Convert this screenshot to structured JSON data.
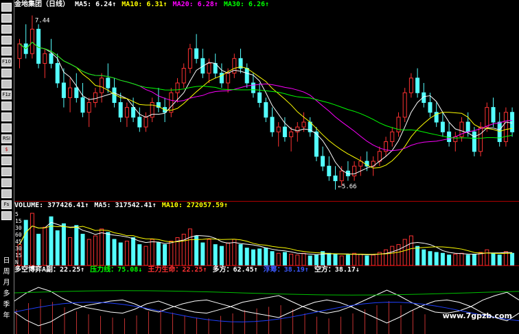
{
  "toolbar": {
    "items": [
      "",
      "",
      "",
      "",
      "",
      "F10",
      "",
      "",
      "F1z",
      "",
      "",
      "",
      "RSI",
      "$",
      "",
      "",
      "",
      "",
      "Fs",
      "",
      "日",
      "周",
      "月",
      "多",
      "季",
      "年"
    ]
  },
  "price_legend": {
    "name": "金地集团（日线）",
    "ma5": "MA5: 6.24↑",
    "ma10": "MA10: 6.31↑",
    "ma20": "MA20: 6.28↑",
    "ma30": "MA30: 6.26↑"
  },
  "high_label": "7.44",
  "low_label": "←5.66",
  "volume_legend": {
    "vol": "VOLUME: 377426.41↑",
    "ma5": "MA5: 317542.41↑",
    "ma10": "MA10: 272057.59↑"
  },
  "volume_axis": [
    "5",
    "15",
    "30",
    "60",
    "45",
    "30",
    "15",
    "N"
  ],
  "indicator_legend": {
    "name": "多空博弈A副：22.25↑",
    "pressure": "压力线：75.08↓",
    "main": "王力生命：22.25↑",
    "bull": "多方：62.45↑",
    "float": "浮筹：38.19↑",
    "bear": "空方：38.17↓"
  },
  "watermark": "www.7gpzb.com",
  "colors": {
    "up": "#ff3232",
    "down": "#54ffff",
    "ma5": "#ffffff",
    "ma10": "#ffff00",
    "ma20": "#ff00ff",
    "ma30": "#00ff00",
    "grid": "#b00000"
  },
  "chart_data": {
    "type": "candlestick",
    "title": "金地集团（日线）",
    "price_ylim": [
      5.6,
      7.5
    ],
    "candles": [
      [
        7.0,
        7.2,
        6.9,
        7.15
      ],
      [
        7.15,
        7.35,
        7.0,
        7.05
      ],
      [
        7.05,
        7.44,
        7.0,
        7.3
      ],
      [
        7.3,
        7.35,
        6.9,
        6.95
      ],
      [
        6.95,
        7.1,
        6.8,
        7.05
      ],
      [
        7.05,
        7.2,
        6.9,
        6.95
      ],
      [
        6.95,
        7.05,
        6.7,
        6.75
      ],
      [
        6.75,
        6.9,
        6.5,
        6.6
      ],
      [
        6.6,
        6.8,
        6.45,
        6.7
      ],
      [
        6.7,
        6.85,
        6.55,
        6.6
      ],
      [
        6.6,
        6.75,
        6.4,
        6.45
      ],
      [
        6.45,
        6.6,
        6.3,
        6.55
      ],
      [
        6.55,
        6.7,
        6.5,
        6.65
      ],
      [
        6.65,
        6.85,
        6.55,
        6.8
      ],
      [
        6.8,
        6.95,
        6.65,
        6.7
      ],
      [
        6.7,
        6.8,
        6.5,
        6.55
      ],
      [
        6.55,
        6.65,
        6.35,
        6.4
      ],
      [
        6.4,
        6.55,
        6.3,
        6.5
      ],
      [
        6.5,
        6.6,
        6.35,
        6.4
      ],
      [
        6.4,
        6.5,
        6.25,
        6.3
      ],
      [
        6.3,
        6.45,
        6.25,
        6.4
      ],
      [
        6.4,
        6.6,
        6.35,
        6.55
      ],
      [
        6.55,
        6.7,
        6.45,
        6.5
      ],
      [
        6.5,
        6.6,
        6.35,
        6.45
      ],
      [
        6.45,
        6.7,
        6.4,
        6.65
      ],
      [
        6.65,
        6.8,
        6.55,
        6.75
      ],
      [
        6.75,
        6.95,
        6.7,
        6.9
      ],
      [
        6.9,
        7.15,
        6.85,
        7.1
      ],
      [
        7.1,
        7.25,
        6.95,
        7.0
      ],
      [
        7.0,
        7.1,
        6.8,
        6.85
      ],
      [
        6.85,
        7.0,
        6.75,
        6.95
      ],
      [
        6.95,
        7.05,
        6.8,
        6.85
      ],
      [
        6.85,
        6.95,
        6.7,
        6.75
      ],
      [
        6.75,
        6.9,
        6.65,
        6.85
      ],
      [
        6.85,
        7.05,
        6.8,
        7.0
      ],
      [
        7.0,
        7.1,
        6.85,
        6.9
      ],
      [
        6.9,
        6.95,
        6.7,
        6.75
      ],
      [
        6.75,
        6.85,
        6.6,
        6.65
      ],
      [
        6.65,
        6.75,
        6.5,
        6.55
      ],
      [
        6.55,
        6.6,
        6.35,
        6.4
      ],
      [
        6.4,
        6.5,
        6.2,
        6.25
      ],
      [
        6.25,
        6.35,
        6.1,
        6.3
      ],
      [
        6.3,
        6.4,
        6.15,
        6.2
      ],
      [
        6.2,
        6.3,
        6.05,
        6.25
      ],
      [
        6.25,
        6.35,
        6.15,
        6.3
      ],
      [
        6.3,
        6.45,
        6.25,
        6.35
      ],
      [
        6.35,
        6.4,
        6.2,
        6.25
      ],
      [
        6.25,
        6.3,
        5.95,
        6.0
      ],
      [
        6.0,
        6.1,
        5.85,
        5.9
      ],
      [
        5.9,
        6.0,
        5.75,
        5.8
      ],
      [
        5.8,
        5.9,
        5.66,
        5.75
      ],
      [
        5.75,
        5.9,
        5.7,
        5.85
      ],
      [
        5.85,
        5.95,
        5.75,
        5.8
      ],
      [
        5.8,
        5.95,
        5.75,
        5.9
      ],
      [
        5.9,
        6.0,
        5.8,
        5.95
      ],
      [
        5.95,
        6.05,
        5.85,
        5.9
      ],
      [
        5.9,
        6.0,
        5.8,
        5.95
      ],
      [
        5.95,
        6.1,
        5.9,
        6.05
      ],
      [
        6.05,
        6.2,
        6.0,
        6.15
      ],
      [
        6.15,
        6.3,
        6.1,
        6.25
      ],
      [
        6.25,
        6.45,
        6.2,
        6.4
      ],
      [
        6.4,
        6.7,
        6.35,
        6.65
      ],
      [
        6.65,
        6.85,
        6.6,
        6.8
      ],
      [
        6.8,
        6.9,
        6.6,
        6.65
      ],
      [
        6.65,
        6.75,
        6.5,
        6.55
      ],
      [
        6.55,
        6.65,
        6.4,
        6.45
      ],
      [
        6.45,
        6.55,
        6.3,
        6.35
      ],
      [
        6.35,
        6.45,
        6.2,
        6.25
      ],
      [
        6.25,
        6.35,
        6.1,
        6.15
      ],
      [
        6.15,
        6.25,
        6.05,
        6.2
      ],
      [
        6.2,
        6.4,
        6.15,
        6.35
      ],
      [
        6.35,
        6.45,
        6.2,
        6.25
      ],
      [
        6.25,
        6.3,
        6.0,
        6.05
      ],
      [
        6.05,
        6.35,
        6.0,
        6.3
      ],
      [
        6.3,
        6.55,
        6.25,
        6.5
      ],
      [
        6.5,
        6.6,
        6.3,
        6.35
      ],
      [
        6.35,
        6.45,
        6.1,
        6.15
      ],
      [
        6.15,
        6.5,
        6.1,
        6.45
      ],
      [
        6.45,
        6.5,
        6.2,
        6.25
      ]
    ],
    "volume": [
      120,
      260,
      300,
      180,
      220,
      280,
      200,
      240,
      160,
      230,
      180,
      150,
      170,
      210,
      190,
      150,
      130,
      140,
      160,
      120,
      110,
      150,
      130,
      120,
      140,
      160,
      180,
      210,
      170,
      130,
      150,
      120,
      110,
      130,
      150,
      120,
      100,
      90,
      95,
      100,
      80,
      70,
      75,
      65,
      60,
      70,
      55,
      60,
      80,
      70,
      65,
      55,
      60,
      70,
      65,
      55,
      60,
      75,
      90,
      110,
      120,
      150,
      170,
      110,
      90,
      80,
      75,
      70,
      60,
      65,
      70,
      60,
      65,
      75,
      90,
      70,
      60,
      80,
      70
    ],
    "indicator": {
      "bull": [
        60,
        75,
        85,
        78,
        65,
        55,
        48,
        44,
        40,
        38,
        45,
        55,
        60,
        52,
        45,
        40,
        38,
        44,
        50,
        58,
        62,
        66,
        70,
        60,
        50,
        42,
        38,
        42,
        50,
        60,
        70,
        80,
        70,
        58,
        48,
        40,
        38,
        42,
        50,
        62,
        70,
        76,
        62
      ]
    }
  }
}
